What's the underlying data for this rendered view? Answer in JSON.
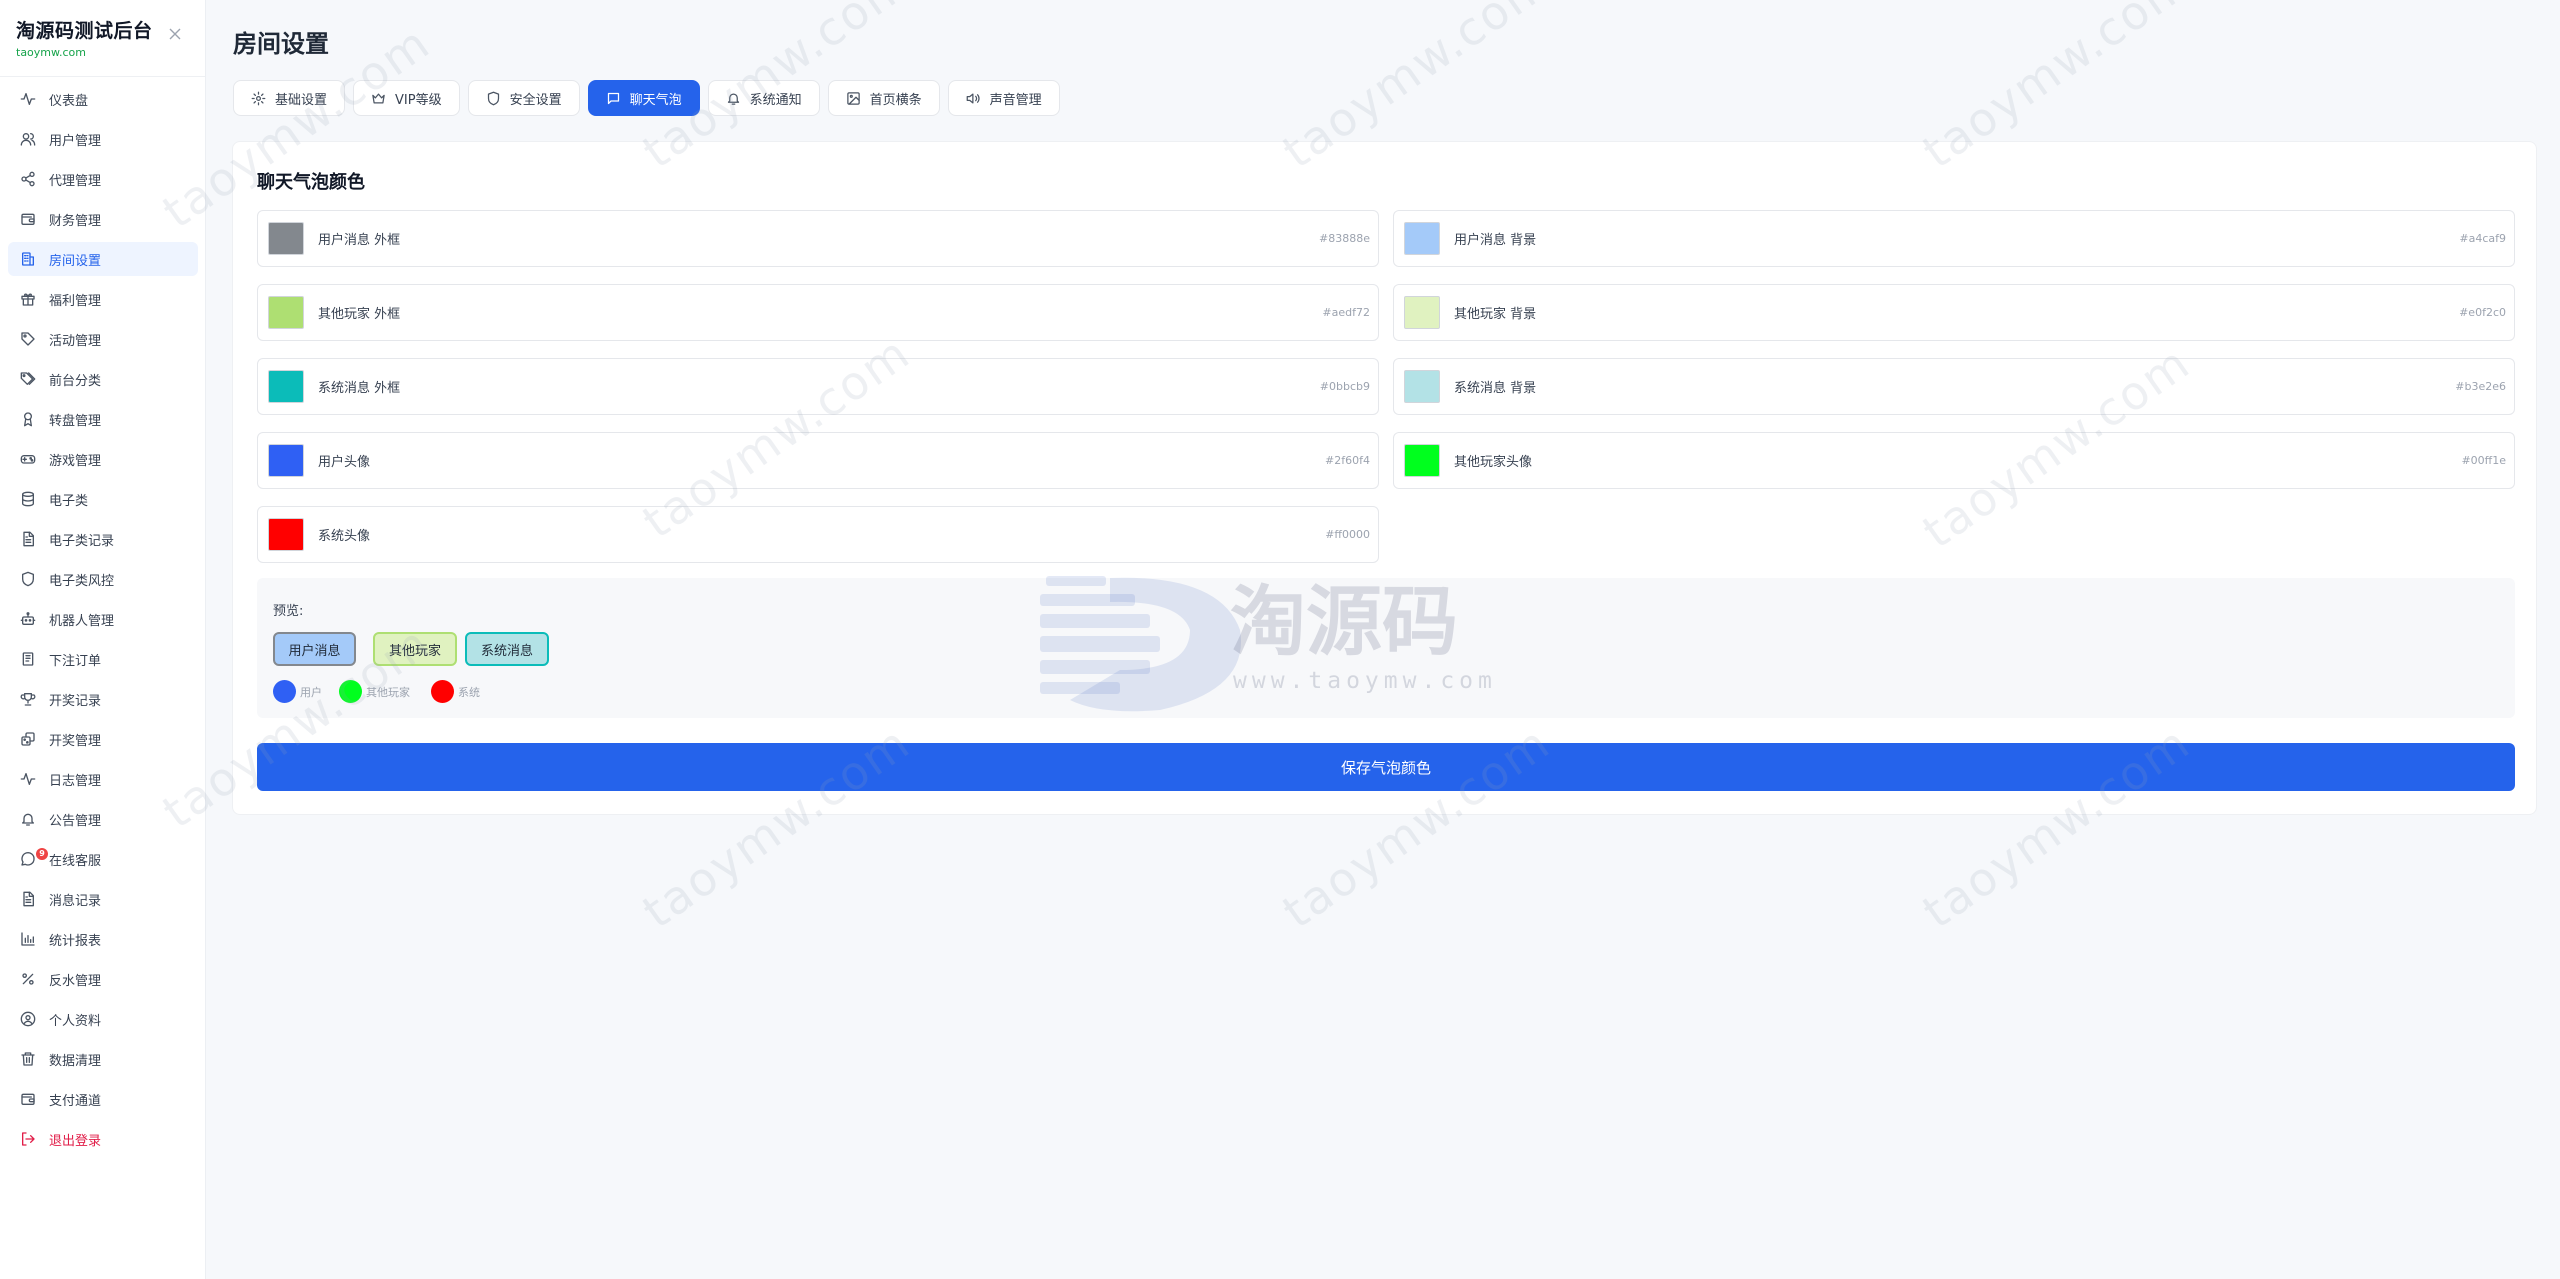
{
  "brand": {
    "title": "淘源码测试后台",
    "subtitle": "taoymw.com"
  },
  "sidebar": {
    "items": [
      {
        "label": "仪表盘",
        "icon": "activity-icon"
      },
      {
        "label": "用户管理",
        "icon": "users-icon"
      },
      {
        "label": "代理管理",
        "icon": "share-icon"
      },
      {
        "label": "财务管理",
        "icon": "wallet-icon"
      },
      {
        "label": "房间设置",
        "icon": "building-icon",
        "active": true
      },
      {
        "label": "福利管理",
        "icon": "gift-icon"
      },
      {
        "label": "活动管理",
        "icon": "tag-icon"
      },
      {
        "label": "前台分类",
        "icon": "tags-icon"
      },
      {
        "label": "转盘管理",
        "icon": "award-icon"
      },
      {
        "label": "游戏管理",
        "icon": "gamepad-icon"
      },
      {
        "label": "电子类",
        "icon": "database-icon"
      },
      {
        "label": "电子类记录",
        "icon": "file-text-icon"
      },
      {
        "label": "电子类风控",
        "icon": "shield-icon"
      },
      {
        "label": "机器人管理",
        "icon": "bot-icon"
      },
      {
        "label": "下注订单",
        "icon": "receipt-icon"
      },
      {
        "label": "开奖记录",
        "icon": "trophy-icon"
      },
      {
        "label": "开奖管理",
        "icon": "dice-icon"
      },
      {
        "label": "日志管理",
        "icon": "activity-icon"
      },
      {
        "label": "公告管理",
        "icon": "bell-icon"
      },
      {
        "label": "在线客服",
        "icon": "message-circle-icon",
        "badge": "9"
      },
      {
        "label": "消息记录",
        "icon": "file-text-icon"
      },
      {
        "label": "统计报表",
        "icon": "bar-chart-icon"
      },
      {
        "label": "反水管理",
        "icon": "percent-icon"
      },
      {
        "label": "个人资料",
        "icon": "user-circle-icon"
      },
      {
        "label": "数据清理",
        "icon": "trash-icon"
      },
      {
        "label": "支付通道",
        "icon": "wallet-icon"
      },
      {
        "label": "退出登录",
        "icon": "logout-icon",
        "danger": true
      }
    ]
  },
  "page": {
    "title": "房间设置"
  },
  "tabs": [
    {
      "label": "基础设置",
      "icon": "gear-icon"
    },
    {
      "label": "VIP等级",
      "icon": "crown-icon"
    },
    {
      "label": "安全设置",
      "icon": "shield-icon"
    },
    {
      "label": "聊天气泡",
      "icon": "message-square-icon",
      "active": true
    },
    {
      "label": "系统通知",
      "icon": "bell-icon"
    },
    {
      "label": "首页横条",
      "icon": "image-icon"
    },
    {
      "label": "声音管理",
      "icon": "volume-icon"
    }
  ],
  "section": {
    "title": "聊天气泡颜色"
  },
  "colors": [
    {
      "label": "用户消息 外框",
      "hex": "#83888e"
    },
    {
      "label": "用户消息 背景",
      "hex": "#a4caf9"
    },
    {
      "label": "其他玩家 外框",
      "hex": "#aedf72"
    },
    {
      "label": "其他玩家 背景",
      "hex": "#e0f2c0"
    },
    {
      "label": "系统消息 外框",
      "hex": "#0bbcb9"
    },
    {
      "label": "系统消息 背景",
      "hex": "#b3e2e6"
    },
    {
      "label": "用户头像",
      "hex": "#2f60f4"
    },
    {
      "label": "其他玩家头像",
      "hex": "#00ff1e"
    },
    {
      "label": "系统头像",
      "hex": "#ff0000"
    }
  ],
  "preview": {
    "label": "预览:",
    "bubbles": [
      {
        "text": "用户消息",
        "border": "#83888e",
        "bg": "#a4caf9"
      },
      {
        "text": "其他玩家",
        "border": "#aedf72",
        "bg": "#e0f2c0"
      },
      {
        "text": "系统消息",
        "border": "#0bbcb9",
        "bg": "#b3e2e6"
      }
    ],
    "avatars": [
      {
        "label": "用户",
        "color": "#2f60f4"
      },
      {
        "label": "其他玩家",
        "color": "#00ff1e"
      },
      {
        "label": "系统",
        "color": "#ff0000"
      }
    ]
  },
  "save_button": {
    "label": "保存气泡颜色"
  },
  "watermark": {
    "text": "taoymw.com",
    "logo_text": "淘源码",
    "logo_url": "www.taoymw.com"
  }
}
